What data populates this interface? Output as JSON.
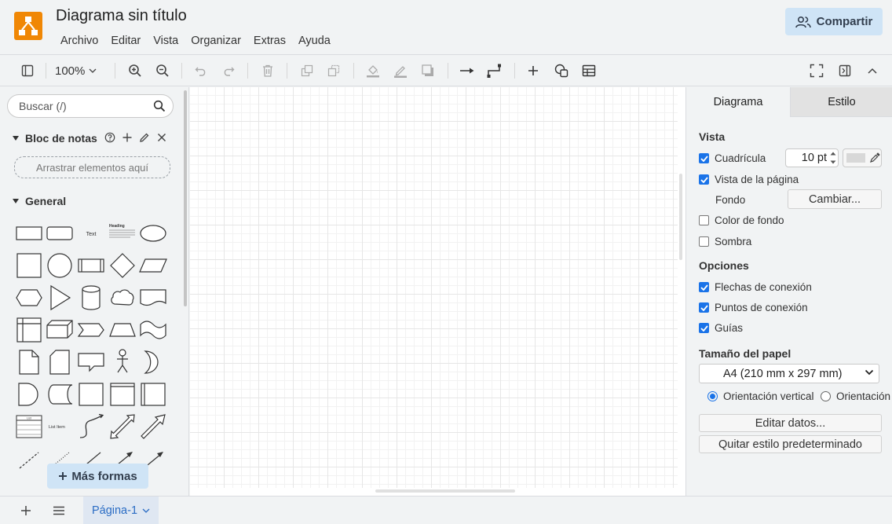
{
  "app": {
    "title": "Diagrama sin título",
    "accent_color": "#f08705",
    "share_label": "Compartir"
  },
  "menu": [
    "Archivo",
    "Editar",
    "Vista",
    "Organizar",
    "Extras",
    "Ayuda"
  ],
  "toolbar": {
    "zoom": "100%",
    "icons": [
      "sidebar-icon",
      "zoom-in-icon",
      "zoom-out-icon",
      "undo-icon",
      "redo-icon",
      "delete-icon",
      "to-front-icon",
      "to-back-icon",
      "fill-color-icon",
      "line-color-icon",
      "shadow-icon",
      "connection-arrow-icon",
      "waypoints-icon",
      "insert-icon",
      "shapes-icon",
      "table-icon",
      "fullscreen-icon",
      "format-panel-icon",
      "collapse-icon"
    ]
  },
  "sidebar": {
    "search_placeholder": "Buscar (/)",
    "notes_title": "Bloc de notas",
    "notes_drop": "Arrastrar elementos aquí",
    "general_title": "General",
    "more_shapes": "Más formas",
    "shape_labels": {
      "text": "Text",
      "heading": "Heading",
      "list_item": "List Item",
      "list": "List"
    }
  },
  "format_panel": {
    "tabs": [
      "Diagrama",
      "Estilo"
    ],
    "active_tab": "Diagrama",
    "view_heading": "Vista",
    "grid_label": "Cuadrícula",
    "grid_checked": true,
    "grid_size": "10 pt",
    "page_view_label": "Vista de la página",
    "page_view_checked": true,
    "background_label": "Fondo",
    "change_button": "Cambiar...",
    "bg_color_label": "Color de fondo",
    "bg_color_checked": false,
    "shadow_label": "Sombra",
    "shadow_checked": false,
    "options_heading": "Opciones",
    "options": [
      {
        "label": "Flechas de conexión",
        "checked": true
      },
      {
        "label": "Puntos de conexión",
        "checked": true
      },
      {
        "label": "Guías",
        "checked": true
      }
    ],
    "paper_heading": "Tamaño del papel",
    "paper_size": "A4 (210 mm x 297 mm)",
    "orientation_portrait": "Orientación vertical",
    "orientation_landscape": "Orientación",
    "orientation_selected": "portrait",
    "edit_data_button": "Editar datos...",
    "clear_style_button": "Quitar estilo predeterminado"
  },
  "pages": {
    "current": "Página-1"
  }
}
